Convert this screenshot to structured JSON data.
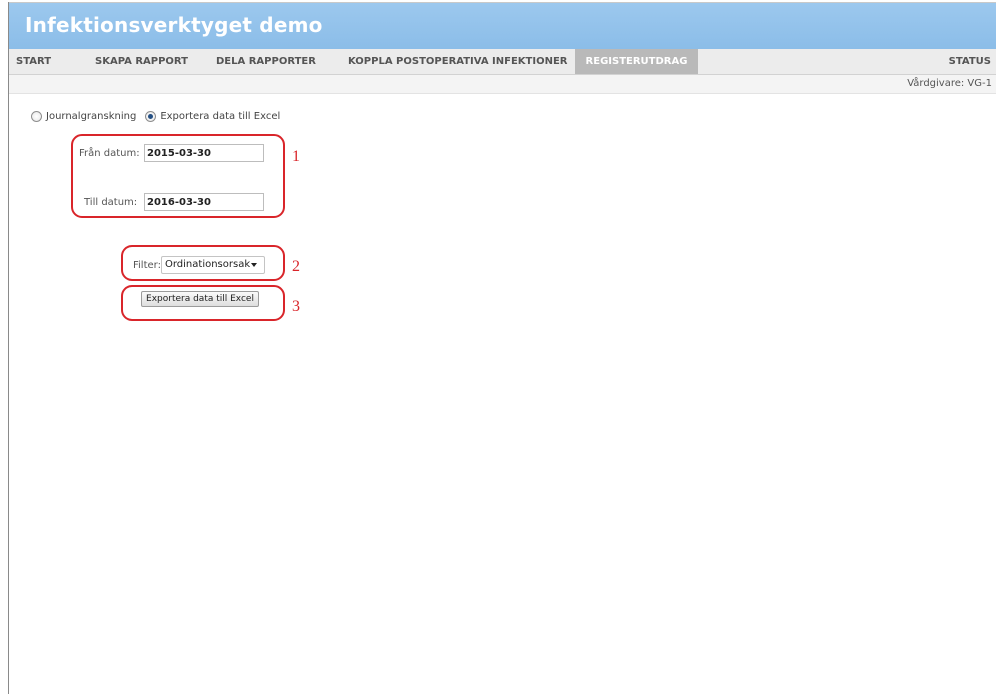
{
  "app": {
    "title": "Infektionsverktyget demo"
  },
  "nav": {
    "items": [
      {
        "label": "START"
      },
      {
        "label": "SKAPA RAPPORT"
      },
      {
        "label": "DELA RAPPORTER"
      },
      {
        "label": "KOPPLA POSTOPERATIVA INFEKTIONER"
      },
      {
        "label": "REGISTERUTDRAG",
        "active": true
      },
      {
        "label": "STATUS"
      }
    ]
  },
  "provider": {
    "text": "Vårdgivare: VG-1"
  },
  "mode": {
    "options": [
      {
        "label": "Journalgranskning",
        "checked": false
      },
      {
        "label": "Exportera data till Excel",
        "checked": true
      }
    ]
  },
  "form": {
    "from_label": "Från datum:",
    "from_value": "2015-03-30",
    "to_label": "Till datum:",
    "to_value": "2016-03-30",
    "filter_label": "Filter:",
    "filter_value": "Ordinationsorsak",
    "export_button": "Exportera data till Excel"
  },
  "annotations": {
    "labels": [
      "1",
      "2",
      "3"
    ],
    "color": "#d9252a"
  },
  "colors": {
    "header": "#8bbde8",
    "nav_active": "#b9b9b9",
    "accent": "#244f83"
  }
}
